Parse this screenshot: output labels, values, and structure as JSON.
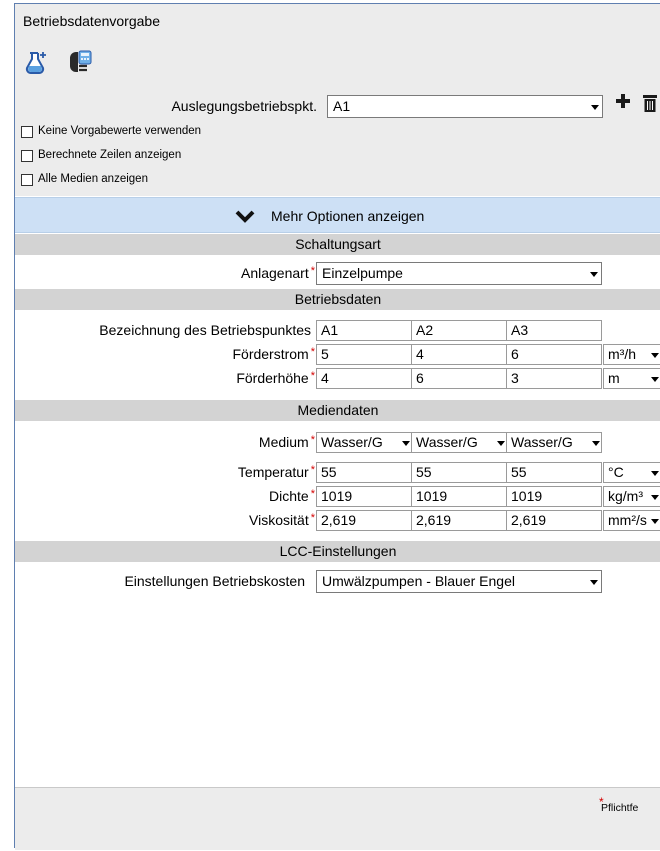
{
  "window": {
    "title": "Betriebsdatenvorgabe"
  },
  "toolbar": {
    "icons": [
      "flask-plus-icon",
      "plug-calculator-icon"
    ]
  },
  "design_point": {
    "label": "Auslegungsbetriebspkt.",
    "value": "A1"
  },
  "checkboxes": [
    {
      "label": "Keine Vorgabewerte verwenden",
      "checked": false
    },
    {
      "label": "Berechnete Zeilen anzeigen",
      "checked": false
    },
    {
      "label": "Alle Medien anzeigen",
      "checked": false
    }
  ],
  "more_options": {
    "label": "Mehr Optionen anzeigen"
  },
  "sections": {
    "schaltungsart": "Schaltungsart",
    "betriebsdaten": "Betriebsdaten",
    "mediendaten": "Mediendaten",
    "lcc": "LCC-Einstellungen"
  },
  "anlagenart": {
    "label": "Anlagenart",
    "value": "Einzelpumpe"
  },
  "betriebsdaten": {
    "points_label": "Bezeichnung des Betriebspunktes",
    "points": [
      "A1",
      "A2",
      "A3"
    ],
    "rows": [
      {
        "label": "Förderstrom",
        "values": [
          "5",
          "4",
          "6"
        ],
        "unit": "m³/h"
      },
      {
        "label": "Förderhöhe",
        "values": [
          "4",
          "6",
          "3"
        ],
        "unit": "m"
      }
    ]
  },
  "mediendaten": {
    "medium": {
      "label": "Medium",
      "values": [
        "Wasser/G",
        "Wasser/G",
        "Wasser/G"
      ]
    },
    "rows": [
      {
        "label": "Temperatur",
        "values": [
          "55",
          "55",
          "55"
        ],
        "unit": "°C"
      },
      {
        "label": "Dichte",
        "values": [
          "1019",
          "1019",
          "1019"
        ],
        "unit": "kg/m³"
      },
      {
        "label": "Viskosität",
        "values": [
          "2,619",
          "2,619",
          "2,619"
        ],
        "unit": "mm²/s"
      }
    ]
  },
  "lcc": {
    "label": "Einstellungen Betriebskosten",
    "value": "Umwälzpumpen - Blauer Engel"
  },
  "footer": {
    "required_note": "Pflichtfe",
    "required_marker": "*"
  },
  "colors": {
    "accent_band": "#cde0f5",
    "section": "#d3d3d3",
    "required": "#d40000",
    "frame": "#5f7fb0"
  }
}
